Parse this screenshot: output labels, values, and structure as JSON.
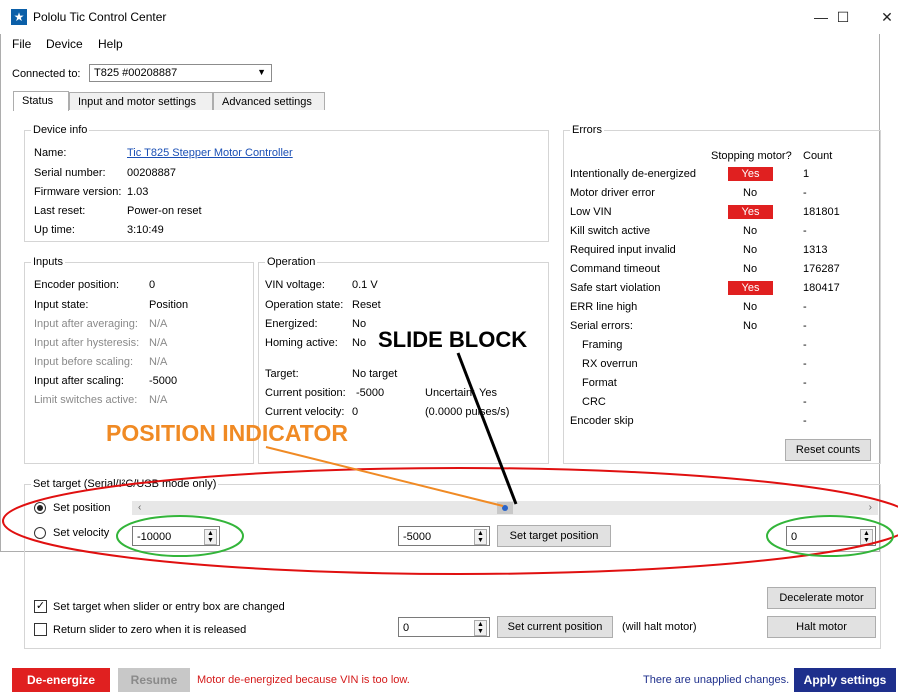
{
  "window": {
    "title": "Pololu Tic Control Center",
    "minimize": "—",
    "maximize": "☐",
    "close": "✕"
  },
  "menu": [
    "File",
    "Device",
    "Help"
  ],
  "connection": {
    "label": "Connected to:",
    "device": "T825 #00208887"
  },
  "tabs": [
    "Status",
    "Input and motor settings",
    "Advanced settings"
  ],
  "device_info": {
    "title": "Device info",
    "rows": [
      {
        "label": "Name:",
        "value": "Tic T825 Stepper Motor Controller"
      },
      {
        "label": "Serial number:",
        "value": "00208887"
      },
      {
        "label": "Firmware version:",
        "value": "1.03"
      },
      {
        "label": "Last reset:",
        "value": "Power-on reset"
      },
      {
        "label": "Up time:",
        "value": "3:10:49"
      }
    ]
  },
  "inputs": {
    "title": "Inputs",
    "rows": [
      {
        "label": "Encoder position:",
        "value": "0"
      },
      {
        "label": "Input state:",
        "value": "Position"
      },
      {
        "label": "Input after averaging:",
        "value": "N/A"
      },
      {
        "label": "Input after hysteresis:",
        "value": "N/A"
      },
      {
        "label": "Input before scaling:",
        "value": "N/A"
      },
      {
        "label": "Input after scaling:",
        "value": "-5000"
      },
      {
        "label": "Limit switches active:",
        "value": "N/A"
      }
    ]
  },
  "operation": {
    "title": "Operation",
    "vin_label": "VIN voltage:",
    "vin": "0.1 V",
    "state_label": "Operation state:",
    "state": "Reset",
    "energized_label": "Energized:",
    "energized": "No",
    "homing_label": "Homing active:",
    "homing": "No",
    "target_label": "Target:",
    "target": "No target",
    "curpos_label": "Current position:",
    "curpos": "-5000",
    "uncertain_label": "Uncertain:",
    "uncertain": "Yes",
    "curvel_label": "Current velocity:",
    "curvel": "0",
    "pulses": "(0.0000 pulses/s)"
  },
  "errors": {
    "title": "Errors",
    "col_stopping": "Stopping motor?",
    "col_count": "Count",
    "rows": [
      {
        "name": "Intentionally de-energized",
        "stopping": "Yes",
        "count": "1"
      },
      {
        "name": "Motor driver error",
        "stopping": "No",
        "count": "-"
      },
      {
        "name": "Low VIN",
        "stopping": "Yes",
        "count": "181801"
      },
      {
        "name": "Kill switch active",
        "stopping": "No",
        "count": "-"
      },
      {
        "name": "Required input invalid",
        "stopping": "No",
        "count": "1313"
      },
      {
        "name": "Command timeout",
        "stopping": "No",
        "count": "176287"
      },
      {
        "name": "Safe start violation",
        "stopping": "Yes",
        "count": "180417"
      },
      {
        "name": "ERR line high",
        "stopping": "No",
        "count": "-"
      },
      {
        "name": "Serial errors:",
        "stopping": "No",
        "count": "-"
      },
      {
        "name": "Framing",
        "stopping": "",
        "count": "-"
      },
      {
        "name": "RX overrun",
        "stopping": "",
        "count": "-"
      },
      {
        "name": "Format",
        "stopping": "",
        "count": "-"
      },
      {
        "name": "CRC",
        "stopping": "",
        "count": "-"
      },
      {
        "name": "Encoder skip",
        "stopping": "",
        "count": "-"
      }
    ],
    "reset_button": "Reset counts"
  },
  "set_target": {
    "title": "Set target (Serial/I²C/USB mode only)",
    "set_position": "Set position",
    "set_velocity": "Set velocity",
    "slider_min": "-10000",
    "slider_max": "0",
    "target_value": "-5000",
    "set_target_button": "Set target position",
    "slider_value_fraction": 0.5
  },
  "bottom_controls": {
    "check_set_target": "Set target when slider or entry box are changed",
    "check_return": "Return slider to zero when it is released",
    "current_pos_value": "0",
    "set_current_button": "Set current position",
    "will_halt": "(will halt motor)",
    "decelerate_button": "Decelerate motor",
    "halt_button": "Halt motor"
  },
  "bottom_bar": {
    "deenergize": "De-energize",
    "resume": "Resume",
    "status_msg": "Motor de-energized because VIN is too low.",
    "unapplied": "There are unapplied changes.",
    "apply": "Apply settings"
  },
  "annotations": {
    "slide_block": "SLIDE BLOCK",
    "position_indicator": "POSITION INDICATOR"
  },
  "colors": {
    "error_red": "#e02020",
    "apply_blue": "#1e2f8c",
    "annotation_orange": "#f08a24",
    "ellipse_red": "#e01010",
    "ellipse_green": "#33b53a"
  }
}
